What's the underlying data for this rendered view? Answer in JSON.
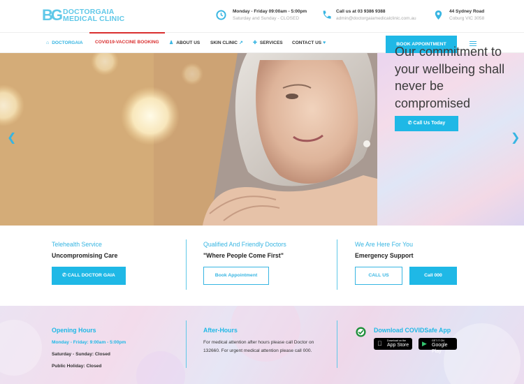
{
  "header": {
    "logo_mark": "BG",
    "logo_line1": "DOCTORGAIA",
    "logo_line2": "MEDICAL CLINIC",
    "hours_line1": "Monday - Friday 09:00am - 5:00pm",
    "hours_line2": "Saturday and Sunday - CLOSED",
    "call_line1": "Call us at 03 9386 9388",
    "call_line2": "admin@doctorgaiamedicalclinic.com.au",
    "address_line1": "44 Sydney Road",
    "address_line2": "Coburg VIC 3058"
  },
  "nav": {
    "items": [
      {
        "label": "DOCTORGAIA",
        "icon": "home-icon"
      },
      {
        "label": "COVID19-VACCINE BOOKING"
      },
      {
        "label": "ABOUT US",
        "icon": "person-icon"
      },
      {
        "label": "SKIN CLINIC",
        "icon": "external-link-icon"
      },
      {
        "label": "SERVICES",
        "icon": "plus-icon"
      },
      {
        "label": "CONTACT US",
        "icon": "heart-icon"
      }
    ],
    "book_label": "BOOK APPOINTMENT"
  },
  "hero": {
    "title": "Our commitment to your wellbeing shall never be compromised",
    "cta_label": "Call Us Today"
  },
  "features": [
    {
      "label": "Telehealth Service",
      "title": "Uncompromising Care",
      "buttons": [
        "CALL DOCTOR GAIA"
      ]
    },
    {
      "label": "Qualified And Friendly Doctors",
      "title": "\"Where People Come First\"",
      "buttons": [
        "Book Appointment"
      ]
    },
    {
      "label": "We Are Here For You",
      "title": "Emergency Support",
      "buttons": [
        "CALL US",
        "Call 000"
      ]
    }
  ],
  "bottom": {
    "hours_heading": "Opening Hours",
    "hours_weekday": "Monday - Friday: 9:00am - 5:00pm",
    "hours_weekend": "Saturday - Sunday: Closed",
    "hours_holiday": "Public Holiday: Closed",
    "after_heading": "After-Hours",
    "after_text": "For medical attention after hours please call Doctor on 132660. For urgent medical attention please call 000.",
    "app_heading": "Download COVIDSafe App",
    "appstore_small": "Download on the",
    "appstore_big": "App Store",
    "play_small": "GET IT ON",
    "play_big": "Google Play"
  },
  "colors": {
    "accent": "#1fb8e6",
    "active_nav": "#d92f2f"
  }
}
